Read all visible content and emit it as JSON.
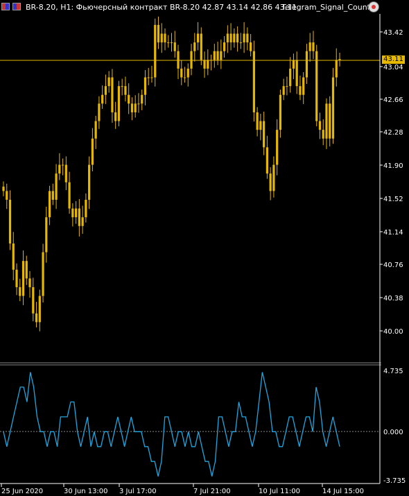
{
  "header": {
    "title": "BR-8.20, H1:  Фьючерсный контракт BR-8.20  42.87 43.14 42.86 43.11",
    "ea_name": "Telegram_Signal_Count",
    "icons": [
      "chart-window-icon",
      "chart-window-icon",
      "expert-advisor-icon"
    ]
  },
  "price_axis": {
    "labels": [
      "43.42",
      "43.04",
      "42.66",
      "42.28",
      "41.90",
      "41.52",
      "41.14",
      "40.76",
      "40.38",
      "40.00"
    ],
    "current_price": "43.11"
  },
  "indicator_axis": {
    "labels": [
      "4.735",
      "0.000",
      "-3.735"
    ]
  },
  "time_axis": {
    "labels": [
      "25 Jun 2020",
      "30 Jun 13:00",
      "3 Jul 17:00",
      "7 Jul 21:00",
      "10 Jul 11:00",
      "14 Jul 15:00"
    ]
  },
  "colors": {
    "background": "#000000",
    "candles": "#e6b800",
    "indicator": "#1ea7e1",
    "price_line": "#e6b800",
    "grid_text": "#ffffff"
  },
  "chart_data": [
    {
      "type": "candlestick",
      "symbol": "BR-8.20",
      "timeframe": "H1",
      "ylim": [
        39.9,
        43.65
      ],
      "close": [
        41.6,
        41.5,
        41.0,
        40.7,
        40.5,
        40.4,
        40.8,
        40.6,
        40.5,
        40.2,
        40.1,
        40.4,
        40.9,
        41.3,
        41.6,
        41.5,
        41.8,
        41.9,
        41.9,
        41.7,
        41.4,
        41.3,
        41.4,
        41.2,
        41.3,
        41.5,
        41.9,
        42.2,
        42.4,
        42.6,
        42.7,
        42.8,
        42.9,
        42.5,
        42.4,
        42.8,
        42.8,
        42.7,
        42.6,
        42.5,
        42.6,
        42.6,
        42.7,
        42.9,
        42.9,
        42.9,
        43.5,
        43.3,
        43.4,
        43.3,
        43.3,
        43.3,
        43.2,
        43.0,
        42.9,
        42.9,
        43.0,
        43.2,
        43.3,
        43.4,
        43.1,
        43.0,
        43.1,
        43.1,
        43.2,
        43.1,
        43.2,
        43.3,
        43.4,
        43.3,
        43.4,
        43.3,
        43.3,
        43.4,
        43.3,
        43.2,
        42.5,
        42.3,
        42.4,
        42.1,
        41.8,
        41.6,
        41.9,
        42.3,
        42.7,
        42.8,
        42.8,
        43.0,
        43.1,
        42.8,
        42.7,
        42.9,
        43.2,
        43.3,
        43.2,
        42.4,
        42.3,
        42.2,
        42.6,
        42.2,
        42.9,
        43.1,
        43.11
      ]
    },
    {
      "type": "line",
      "name": "",
      "ylim": [
        -3.735,
        4.735
      ],
      "values": [
        0,
        -1,
        0,
        1,
        2,
        3,
        3,
        2,
        4,
        3,
        1,
        0,
        0,
        -1,
        0,
        0,
        -1,
        1,
        1,
        1,
        2,
        2,
        0,
        -1,
        0,
        1,
        -1,
        0,
        -1,
        -1,
        0,
        0,
        -1,
        0,
        1,
        0,
        -1,
        0,
        1,
        0,
        0,
        0,
        -1,
        -1,
        -2,
        -2,
        -3,
        -2,
        1,
        1,
        0,
        -1,
        0,
        0,
        -1,
        0,
        -1,
        -1,
        0,
        -1,
        -2,
        -2,
        -3,
        -2,
        1,
        1,
        0,
        -1,
        0,
        0,
        2,
        1,
        1,
        0,
        -1,
        0,
        2,
        4,
        3,
        2,
        0,
        0,
        -1,
        -1,
        0,
        1,
        1,
        0,
        -1,
        0,
        1,
        1,
        0,
        3,
        2,
        0,
        -1,
        0,
        1,
        0,
        -1
      ]
    }
  ]
}
